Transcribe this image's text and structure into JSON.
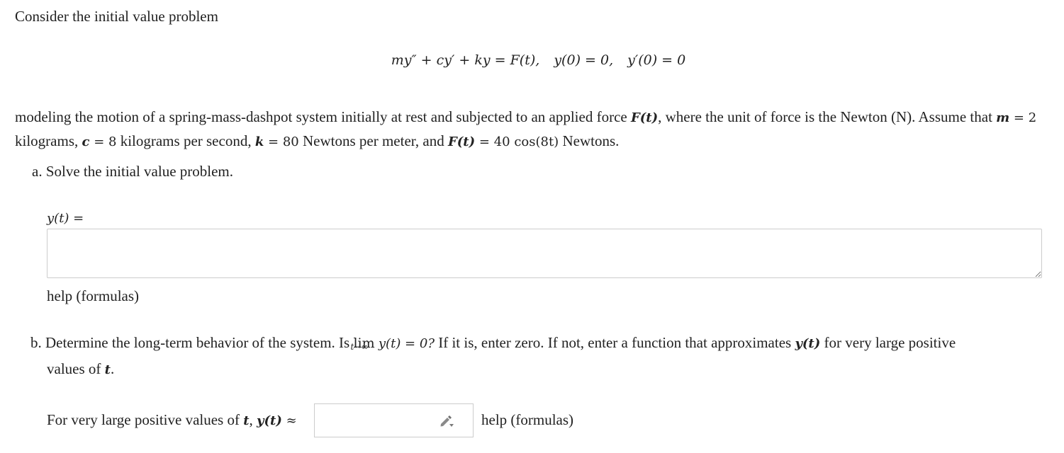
{
  "intro_text": "Consider the initial value problem",
  "equation": {
    "lhs": "my″ + cy′ + ky",
    "rhs": "F(t),",
    "ic1": "y(0) = 0,",
    "ic2": "y′(0) = 0"
  },
  "setup": {
    "p1": "modeling the motion of a spring-mass-dashpot system initially at rest and subjected to an applied force ",
    "ft1": "F(t)",
    "p2": ", where the unit of force is the Newton (N). Assume that ",
    "m_sym": "m",
    "m_val": "2",
    "p3": " kilograms, ",
    "c_sym": "c",
    "c_val": "8",
    "p4": " kilograms per second, ",
    "k_sym": "k",
    "k_val": "80",
    "p5": " Newtons per meter, and ",
    "ft2": "F(t)",
    "force_val": "40 cos(8t)",
    "p6": " Newtons."
  },
  "part_a": {
    "prompt": "a. Solve the initial value problem.",
    "label": "y(t) =",
    "answer_value": "",
    "help_link": "help (formulas)"
  },
  "part_b": {
    "prompt_start": "b. Determine the long-term behavior of the system. Is ",
    "lim_word": "lim",
    "lim_sub": "t→∞",
    "lim_expr": "y(t) = 0?",
    "prompt_mid": " If it is, enter zero. If not, enter a function that approximates ",
    "yt": "y(t)",
    "prompt_end": " for very large positive",
    "line2_start": "values of ",
    "t_sym": "t",
    "line2_end": ".",
    "label_start": "For very large positive values of ",
    "label_t": "t",
    "label_mid": ", ",
    "label_yt": "y(t)",
    "label_approx": " ≈",
    "answer_value": "",
    "help_link": "help (formulas)"
  },
  "icons": {
    "editor": "pencil-icon"
  }
}
